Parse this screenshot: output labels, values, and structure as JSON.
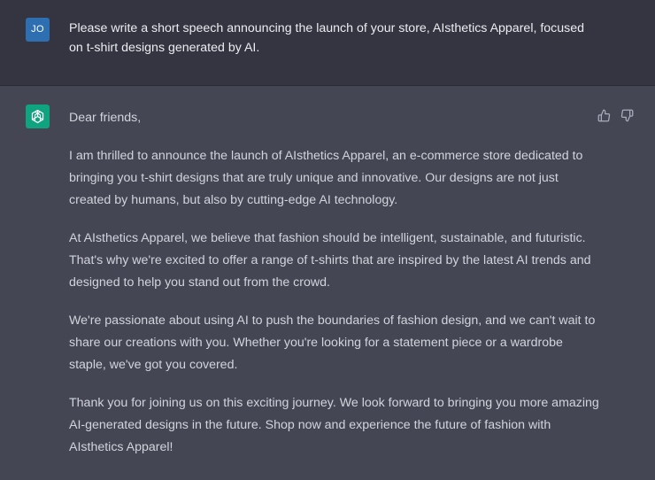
{
  "user": {
    "avatar_initials": "JO",
    "message": "Please write a short speech announcing the launch of your store, AIsthetics Apparel, focused on t-shirt designs generated by AI."
  },
  "assistant": {
    "avatar_icon": "openai-logo-icon",
    "paragraphs": [
      "Dear friends,",
      "I am thrilled to announce the launch of AIsthetics Apparel, an e-commerce store dedicated to bringing you t-shirt designs that are truly unique and innovative. Our designs are not just created by humans, but also by cutting-edge AI technology.",
      "At AIsthetics Apparel, we believe that fashion should be intelligent, sustainable, and futuristic. That's why we're excited to offer a range of t-shirts that are inspired by the latest AI trends and designed to help you stand out from the crowd.",
      "We're passionate about using AI to push the boundaries of fashion design, and we can't wait to share our creations with you. Whether you're looking for a statement piece or a wardrobe staple, we've got you covered.",
      "Thank you for joining us on this exciting journey. We look forward to bringing you more amazing AI-generated designs in the future. Shop now and experience the future of fashion with AIsthetics Apparel!"
    ],
    "feedback": {
      "thumbs_up_icon": "thumbs-up-icon",
      "thumbs_down_icon": "thumbs-down-icon"
    }
  },
  "colors": {
    "user_background": "#343541",
    "assistant_background": "#444654",
    "user_avatar": "#2d6fb1",
    "assistant_avatar": "#10a37f"
  }
}
